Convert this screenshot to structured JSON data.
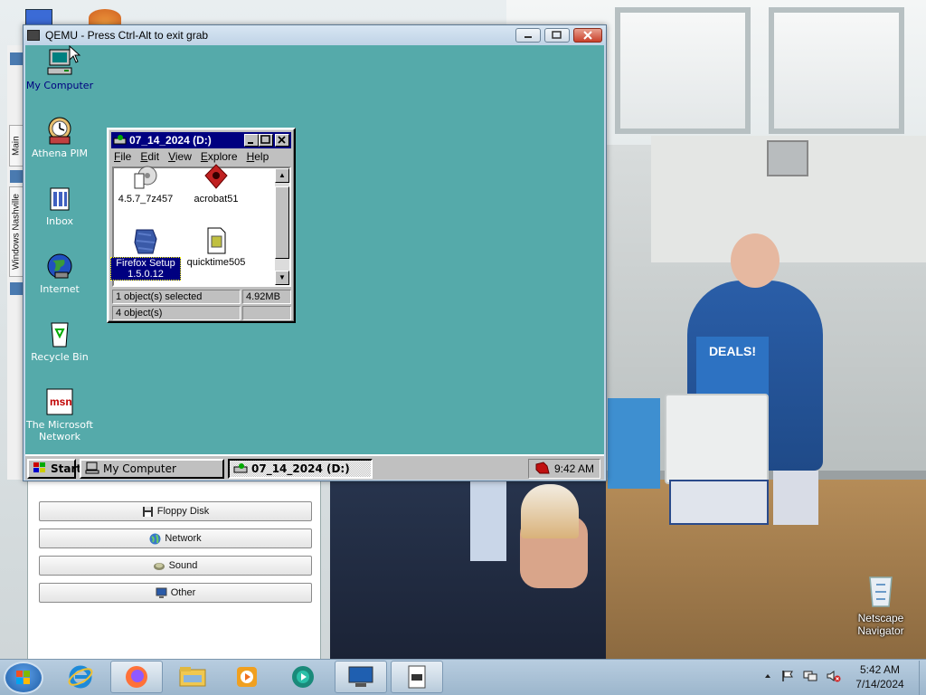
{
  "host": {
    "sidebar_tab_main": "Main",
    "sidebar_tab_windows": "Windows Nashville",
    "panel_buttons": [
      {
        "label": "Floppy Disk",
        "icon": "floppy-icon"
      },
      {
        "label": "Network",
        "icon": "globe-icon"
      },
      {
        "label": "Sound",
        "icon": "speaker-icon"
      },
      {
        "label": "Other",
        "icon": "monitor-icon"
      }
    ],
    "desktop_icons": [
      {
        "label": "Netscape Navigator",
        "icon": "recycle-bin-icon"
      }
    ],
    "photo_sign": "DEALS!",
    "taskbar": {
      "clock_time": "5:42 AM",
      "clock_date": "7/14/2024",
      "buttons": [
        "internet-explorer-icon",
        "firefox-icon",
        "file-explorer-icon",
        "media-player-icon",
        "media-center-icon",
        "computer-window-icon",
        "document-icon"
      ]
    }
  },
  "qemu": {
    "title": "QEMU - Press Ctrl-Alt to exit grab"
  },
  "guest": {
    "desktop_icons": [
      {
        "label": "My Computer",
        "icon": "my-computer-icon"
      },
      {
        "label": "Athena PIM",
        "icon": "athena-pim-icon"
      },
      {
        "label": "Inbox",
        "icon": "inbox-icon"
      },
      {
        "label": "Internet",
        "icon": "internet-icon"
      },
      {
        "label": "Recycle Bin",
        "icon": "recycle-bin-icon"
      },
      {
        "label": "The Microsoft Network",
        "icon": "msn-icon"
      }
    ],
    "explorer": {
      "title": "07_14_2024 (D:)",
      "menu": [
        "File",
        "Edit",
        "View",
        "Explore",
        "Help"
      ],
      "items": [
        {
          "label": "4.5.7_7z457",
          "icon": "installer-icon"
        },
        {
          "label": "acrobat51",
          "icon": "acrobat-icon"
        },
        {
          "label": "Firefox Setup 1.5.0.12",
          "icon": "firefox-setup-icon",
          "selected": true
        },
        {
          "label": "quicktime505",
          "icon": "quicktime-icon"
        }
      ],
      "status_selected": "1 object(s) selected",
      "status_size": "4.92MB",
      "status_count": "4 object(s)"
    },
    "taskbar": {
      "start": "Start",
      "buttons": [
        "My Computer",
        "07_14_2024 (D:)"
      ],
      "clock": "9:42 AM"
    }
  },
  "colors": {
    "guest_desktop": "#55aaaa",
    "titlebar": "#000080",
    "face": "#c0c0c0"
  }
}
